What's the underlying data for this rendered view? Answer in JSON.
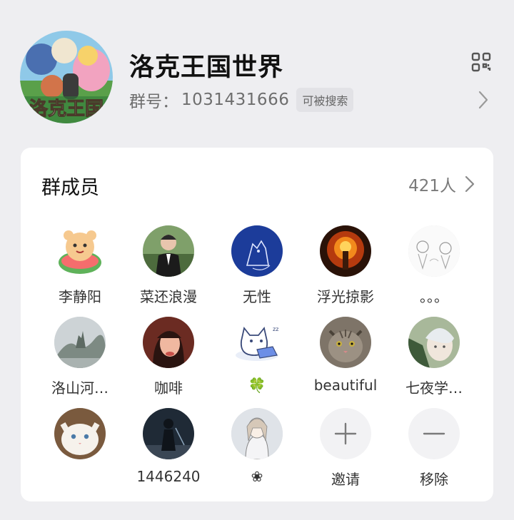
{
  "group": {
    "name": "洛克王国世界",
    "avatar_caption": "洛克王国",
    "id_label": "群号：",
    "id_number": "1031431666",
    "searchable_badge": "可被搜索"
  },
  "members_card": {
    "title": "群成员",
    "count": "421人"
  },
  "members": [
    {
      "name": "李静阳",
      "icon": "bear-in-watermelon-avatar"
    },
    {
      "name": "菜还浪漫",
      "icon": "man-in-suit-avatar"
    },
    {
      "name": "无性",
      "icon": "blue-cat-sketch-avatar"
    },
    {
      "name": "浮光掠影",
      "icon": "fire-figure-avatar"
    },
    {
      "name": "。。。",
      "icon": "pencil-sketch-avatar"
    },
    {
      "name": "洛山河…",
      "icon": "foggy-landscape-avatar"
    },
    {
      "name": "咖啡",
      "icon": "girl-portrait-avatar"
    },
    {
      "name": "🍀",
      "icon": "cartoon-cat-laptop-avatar"
    },
    {
      "name": "beautiful",
      "icon": "tabby-cat-avatar"
    },
    {
      "name": "七夜学…",
      "icon": "white-hair-person-avatar"
    },
    {
      "name": "",
      "icon": "white-kitten-avatar"
    },
    {
      "name": "1446240",
      "icon": "dark-warrior-avatar"
    },
    {
      "name": "❀",
      "icon": "anime-girl-sketch-avatar"
    }
  ],
  "actions": {
    "invite": "邀请",
    "remove": "移除"
  },
  "colors": {
    "background": "#eeeef1",
    "card": "#ffffff",
    "secondary_text": "#7a7a7a"
  }
}
